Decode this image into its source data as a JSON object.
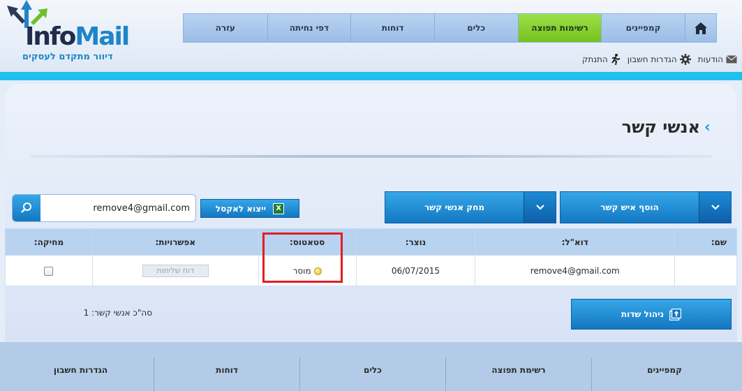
{
  "logo": {
    "word_prefix": "Info",
    "word_suffix": "Mail",
    "tagline": "דיוור מתקדם לעסקים"
  },
  "nav": {
    "items": [
      {
        "label": "קמפיינים",
        "active": false
      },
      {
        "label": "רשימות תפוצה",
        "active": true
      },
      {
        "label": "כלים",
        "active": false
      },
      {
        "label": "דוחות",
        "active": false
      },
      {
        "label": "דפי נחיתה",
        "active": false
      },
      {
        "label": "עזרה",
        "active": false
      }
    ]
  },
  "subnav": {
    "messages": "הודעות",
    "settings": "הגדרות חשבון",
    "logout": "התנתק"
  },
  "page": {
    "title": "אנשי קשר"
  },
  "toolbar": {
    "add_contact": "הוסף איש קשר",
    "delete_contacts": "מחק אנשי קשר",
    "export_excel": "ייצוא לאקסל",
    "search_value": "remove4@gmail.com"
  },
  "table": {
    "headers": {
      "name": "שם:",
      "email": "דוא\"ל:",
      "created": "נוצר:",
      "status": "סטאטוס:",
      "options": "אפשרויות:",
      "delete": "מחיקה:"
    },
    "rows": [
      {
        "name": "",
        "email": "remove4@gmail.com",
        "created": "06/07/2015",
        "status": "מוסר",
        "report": "דוח שליחות"
      }
    ]
  },
  "manage_fields": "ניהול שדות",
  "total": "סה\"כ אנשי קשר: 1",
  "footer": {
    "cols": [
      "קמפיינים",
      "רשימת תפוצה",
      "כלים",
      "דוחות",
      "הגדרות חשבון"
    ]
  },
  "colors": {
    "accent": "#1ec0ee",
    "active_tab": "#7ccb26",
    "button": "#1377c2",
    "highlight": "#e21d22"
  }
}
